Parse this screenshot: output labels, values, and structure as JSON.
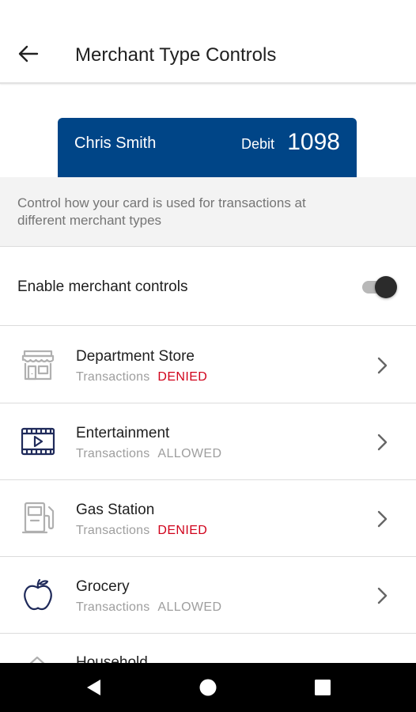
{
  "header": {
    "title": "Merchant Type Controls",
    "back_icon": "arrow-back-icon"
  },
  "card": {
    "name": "Chris Smith",
    "type": "Debit",
    "number": "1098",
    "color": "#004587"
  },
  "description": "Control how your card is used for transactions at different merchant types",
  "toggle": {
    "label": "Enable merchant controls",
    "enabled": true
  },
  "items": [
    {
      "title": "Department Store",
      "sub_label": "Transactions",
      "status": "DENIED",
      "icon": "storefront-icon"
    },
    {
      "title": "Entertainment",
      "sub_label": "Transactions",
      "status": "ALLOWED",
      "icon": "film-icon"
    },
    {
      "title": "Gas Station",
      "sub_label": "Transactions",
      "status": "DENIED",
      "icon": "gas-pump-icon"
    },
    {
      "title": "Grocery",
      "sub_label": "Transactions",
      "status": "ALLOWED",
      "icon": "apple-icon"
    }
  ],
  "partial_item": {
    "title": "Household",
    "icon": "house-icon"
  },
  "colors": {
    "denied": "#d0021b",
    "allowed": "#9e9e9e",
    "navy_icon": "#1f2a5a",
    "grey_icon": "#b0b0b0"
  },
  "navbar": {
    "back": "nav-back-icon",
    "home": "nav-home-icon",
    "recents": "nav-recents-icon"
  }
}
